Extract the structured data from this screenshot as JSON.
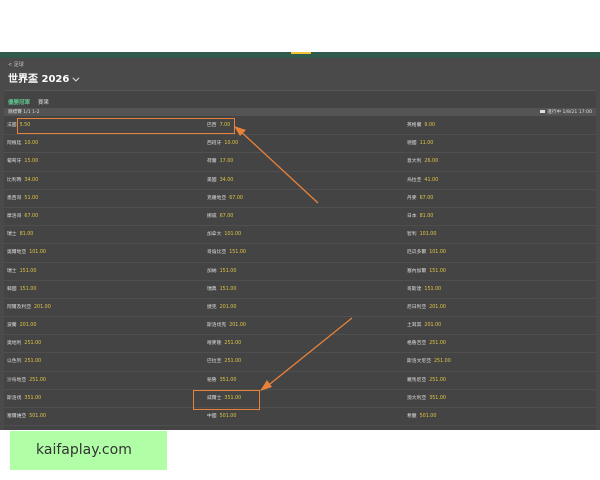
{
  "breadcrumb": "< 足球",
  "title": "世界盃 2026",
  "tabs": [
    {
      "label": "優勝冠軍",
      "active": true
    },
    {
      "label": "賽果",
      "active": false
    }
  ],
  "market": {
    "name": "錦標賽 1/1 1-2",
    "status": "進行中 1/8/21 17:00"
  },
  "columns": [
    [
      {
        "team": "法國",
        "odds": "5.50"
      },
      {
        "team": "阿根廷",
        "odds": "10.00"
      },
      {
        "team": "葡萄牙",
        "odds": "15.00"
      },
      {
        "team": "比利時",
        "odds": "34.00"
      },
      {
        "team": "墨西哥",
        "odds": "51.00"
      },
      {
        "team": "摩洛哥",
        "odds": "67.00"
      },
      {
        "team": "瑞士",
        "odds": "81.00"
      },
      {
        "team": "奧爾地亞",
        "odds": "101.00"
      },
      {
        "team": "瑞士",
        "odds": "151.00"
      },
      {
        "team": "韓國",
        "odds": "151.00"
      },
      {
        "team": "阿爾及利亞",
        "odds": "201.00"
      },
      {
        "team": "波蘭",
        "odds": "201.00"
      },
      {
        "team": "奧地利",
        "odds": "251.00"
      },
      {
        "team": "以色列",
        "odds": "251.00"
      },
      {
        "team": "沙烏地亞",
        "odds": "251.00"
      },
      {
        "team": "斯洛伐",
        "odds": "351.00"
      },
      {
        "team": "塞爾維亞",
        "odds": "501.00"
      },
      {
        "team": "哈薩克",
        "odds": "501.00"
      }
    ],
    [
      {
        "team": "巴西",
        "odds": "7.00"
      },
      {
        "team": "西班牙",
        "odds": "10.00"
      },
      {
        "team": "荷蘭",
        "odds": "17.00"
      },
      {
        "team": "美國",
        "odds": "34.00"
      },
      {
        "team": "克羅地亞",
        "odds": "67.00"
      },
      {
        "team": "挪威",
        "odds": "67.00"
      },
      {
        "team": "加拿大",
        "odds": "101.00"
      },
      {
        "team": "哥倫比亞",
        "odds": "151.00"
      },
      {
        "team": "加納",
        "odds": "151.00"
      },
      {
        "team": "瑞典",
        "odds": "151.00"
      },
      {
        "team": "捷克",
        "odds": "201.00"
      },
      {
        "team": "斯洛伐克",
        "odds": "201.00"
      },
      {
        "team": "喀麥隆",
        "odds": "251.00"
      },
      {
        "team": "巴拉圭",
        "odds": "251.00"
      },
      {
        "team": "秘魯",
        "odds": "351.00"
      },
      {
        "team": "威爾士",
        "odds": "351.00"
      },
      {
        "team": "中國",
        "odds": "501.00"
      },
      {
        "team": "伊朗",
        "odds": "501.00"
      }
    ],
    [
      {
        "team": "英格蘭",
        "odds": "9.00"
      },
      {
        "team": "德國",
        "odds": "11.00"
      },
      {
        "team": "意大利",
        "odds": "26.00"
      },
      {
        "team": "烏拉圭",
        "odds": "41.00"
      },
      {
        "team": "丹麥",
        "odds": "67.00"
      },
      {
        "team": "日本",
        "odds": "81.00"
      },
      {
        "team": "智利",
        "odds": "101.00"
      },
      {
        "team": "厄瓜多爾",
        "odds": "101.00"
      },
      {
        "team": "塞內加爾",
        "odds": "151.00"
      },
      {
        "team": "哥斯達",
        "odds": "151.00"
      },
      {
        "team": "尼日利亞",
        "odds": "201.00"
      },
      {
        "team": "土耳其",
        "odds": "201.00"
      },
      {
        "team": "格魯吉亞",
        "odds": "251.00"
      },
      {
        "team": "斯洛文尼亞",
        "odds": "251.00"
      },
      {
        "team": "羅馬尼亞",
        "odds": "251.00"
      },
      {
        "team": "澳大利亞",
        "odds": "351.00"
      },
      {
        "team": "希臘",
        "odds": "501.00"
      },
      {
        "team": "埃及",
        "odds": "501.00"
      }
    ]
  ],
  "colors": {
    "odds": "#e0c544",
    "highlight": "#e8823a",
    "active_tab": "#5fc08e"
  },
  "watermark": "kaifaplay.com"
}
